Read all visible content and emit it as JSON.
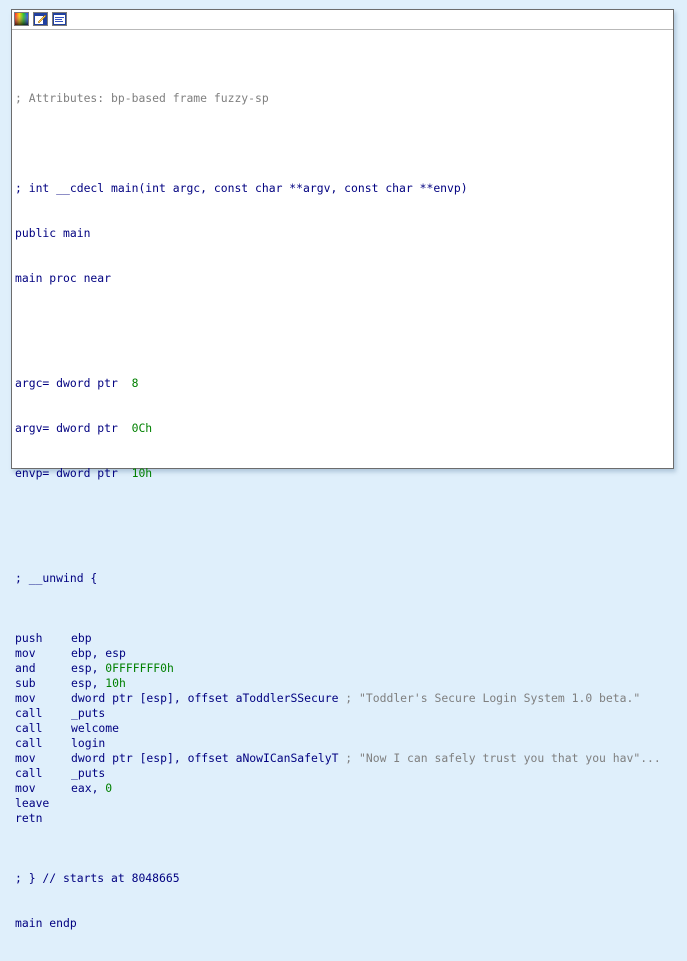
{
  "toolbar": {
    "icons": [
      "graph-view-icon",
      "edit-icon",
      "listing-view-icon"
    ]
  },
  "colors": {
    "code": "#000080",
    "comment": "#7f7f7f",
    "number": "#008000",
    "frame_bg": "#ffffff",
    "outer_bg": "#dfeffb"
  },
  "code": {
    "attributes_comment": "; Attributes: bp-based frame fuzzy-sp",
    "prototype_comment": "; int __cdecl main(int argc, const char **argv, const char **envp)",
    "public_line": "public main",
    "proc_line": "main proc near",
    "args": [
      {
        "name": "argc= dword ptr",
        "value": "8"
      },
      {
        "name": "argv= dword ptr",
        "value": "0Ch"
      },
      {
        "name": "envp= dword ptr",
        "value": "10h"
      }
    ],
    "unwind_start": "; __unwind {",
    "instructions": [
      {
        "mnemonic": "push",
        "op": "ebp",
        "num": "",
        "comment": ""
      },
      {
        "mnemonic": "mov",
        "op": "ebp, esp",
        "num": "",
        "comment": ""
      },
      {
        "mnemonic": "and",
        "op": "esp, ",
        "num": "0FFFFFFF0h",
        "comment": ""
      },
      {
        "mnemonic": "sub",
        "op": "esp, ",
        "num": "10h",
        "comment": ""
      },
      {
        "mnemonic": "mov",
        "op": "dword ptr [esp], offset aToddlerSSecure",
        "num": "",
        "comment": " ; \"Toddler's Secure Login System 1.0 beta.\""
      },
      {
        "mnemonic": "call",
        "op": "_puts",
        "num": "",
        "comment": ""
      },
      {
        "mnemonic": "call",
        "op": "welcome",
        "num": "",
        "comment": ""
      },
      {
        "mnemonic": "call",
        "op": "login",
        "num": "",
        "comment": ""
      },
      {
        "mnemonic": "mov",
        "op": "dword ptr [esp], offset aNowICanSafelyT",
        "num": "",
        "comment": " ; \"Now I can safely trust you that you hav\"..."
      },
      {
        "mnemonic": "call",
        "op": "_puts",
        "num": "",
        "comment": ""
      },
      {
        "mnemonic": "mov",
        "op": "eax, ",
        "num": "0",
        "comment": ""
      },
      {
        "mnemonic": "leave",
        "op": "",
        "num": "",
        "comment": ""
      },
      {
        "mnemonic": "retn",
        "op": "",
        "num": "",
        "comment": ""
      }
    ],
    "unwind_end": "; } // starts at 8048665",
    "endp_line": "main endp"
  }
}
